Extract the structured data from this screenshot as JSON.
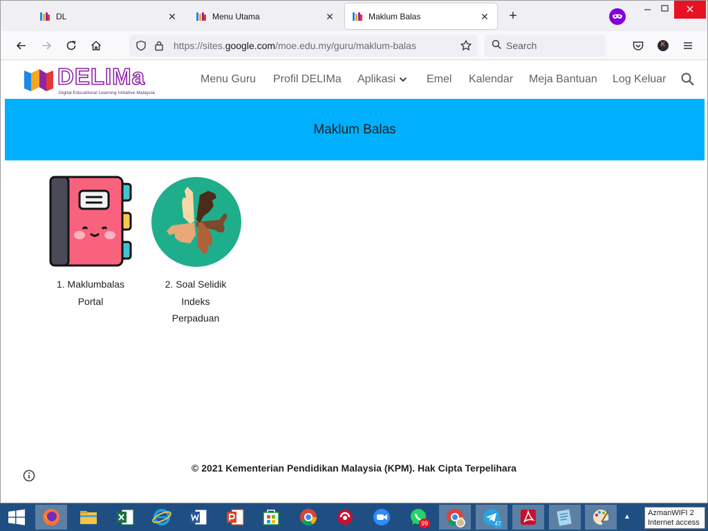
{
  "tabs": [
    {
      "title": "DL"
    },
    {
      "title": "Menu Utama"
    },
    {
      "title": "Maklum Balas"
    }
  ],
  "urlbar": {
    "prefix": "https://sites.",
    "host": "google.com",
    "path": "/moe.edu.my/guru/maklum-balas"
  },
  "searchbar": {
    "placeholder": "Search"
  },
  "profile": {
    "initial": "K"
  },
  "site": {
    "logo_text": "DELIMa",
    "logo_tagline": "Digital Educational Learning Initiative Malaysia",
    "nav": [
      {
        "label": "Menu Guru"
      },
      {
        "label": "Profil DELIMa"
      },
      {
        "label": "Aplikasi"
      },
      {
        "label": "Emel"
      },
      {
        "label": "Kalendar"
      },
      {
        "label": "Meja Bantuan"
      },
      {
        "label": "Log Keluar"
      }
    ]
  },
  "banner": {
    "title": "Maklum Balas",
    "color": "#00b0ff"
  },
  "cards": [
    {
      "lines": [
        "1. Maklumbalas",
        "Portal"
      ]
    },
    {
      "lines": [
        "2. Soal Selidik",
        "Indeks",
        "Perpaduan"
      ]
    }
  ],
  "footer": {
    "text": "© 2021 Kementerian Pendidikan Malaysia (KPM). Hak Cipta Terpelihara"
  },
  "taskbar": {
    "apps": [
      "firefox",
      "file-explorer",
      "excel",
      "internet-explorer",
      "word",
      "powerpoint",
      "store",
      "chrome",
      "antivirus",
      "zoom",
      "whatsapp",
      "chrome-profile",
      "telegram",
      "acrobat",
      "notepad",
      "paint"
    ],
    "whatsapp_badge": "99",
    "telegram_badge": "47",
    "tooltip_lines": [
      "AzmanWIFI  2",
      "Internet access"
    ]
  }
}
